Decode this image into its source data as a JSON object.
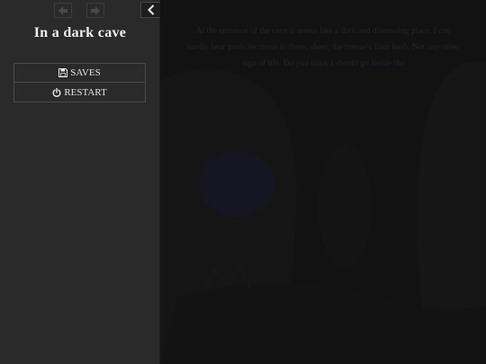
{
  "sidebar": {
    "title": "In a dark cave",
    "menu": {
      "saves_label": "SAVES",
      "restart_label": "RESTART"
    }
  },
  "passage": {
    "text": "At the entrance of the cave it seems like a dark and distressing place. I can hardly hear particles move in there, sheer, the breeze's faint hush. Not any other sign of life. Do you think I should go",
    "link_text": "inside the"
  },
  "colors": {
    "sidebar_bg": "#2a2a2a",
    "passage_bg": "#121212",
    "title_text": "#f0f0f0"
  }
}
